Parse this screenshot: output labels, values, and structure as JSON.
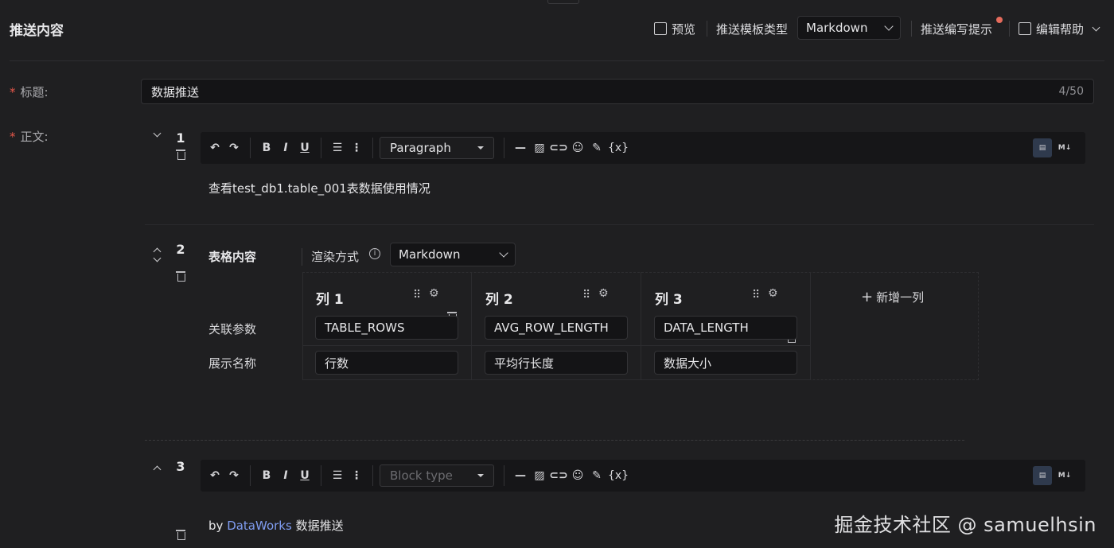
{
  "header": {
    "title": "推送内容",
    "preview_label": "预览",
    "template_type_label": "推送模板类型",
    "template_type_value": "Markdown",
    "writing_tips_label": "推送编写提示",
    "edit_help_label": "编辑帮助"
  },
  "form": {
    "title_label": "标题:",
    "title_value": "数据推送",
    "title_counter": "4/50",
    "body_label": "正文:"
  },
  "toolbar": {
    "undo": "↶",
    "redo": "↷",
    "bold": "B",
    "italic": "I",
    "underline": "U",
    "bullet_list": "☰",
    "ordered_list": "⋮",
    "hr": "—",
    "variable": "{x}",
    "mode_rich": "▤",
    "mode_md": "M↓"
  },
  "blocks": [
    {
      "number": "1",
      "block_type": "Paragraph",
      "text": "查看test_db1.table_001表数据使用情况"
    },
    {
      "number": "2",
      "table_label": "表格内容",
      "render_label": "渲染方式",
      "render_value": "Markdown",
      "columns": [
        {
          "header": "列 1",
          "param": "TABLE_ROWS",
          "display": "行数"
        },
        {
          "header": "列 2",
          "param": "AVG_ROW_LENGTH",
          "display": "平均行长度"
        },
        {
          "header": "列 3",
          "param": "DATA_LENGTH",
          "display": "数据大小"
        }
      ],
      "row_labels": [
        "关联参数",
        "展示名称"
      ],
      "add_column_label": "新增一列"
    },
    {
      "number": "3",
      "block_type_placeholder": "Block type",
      "text_prefix": "by",
      "text_link": "DataWorks",
      "text_suffix": "数据推送"
    }
  ],
  "watermark": "掘金技术社区 @ samuelhsin"
}
